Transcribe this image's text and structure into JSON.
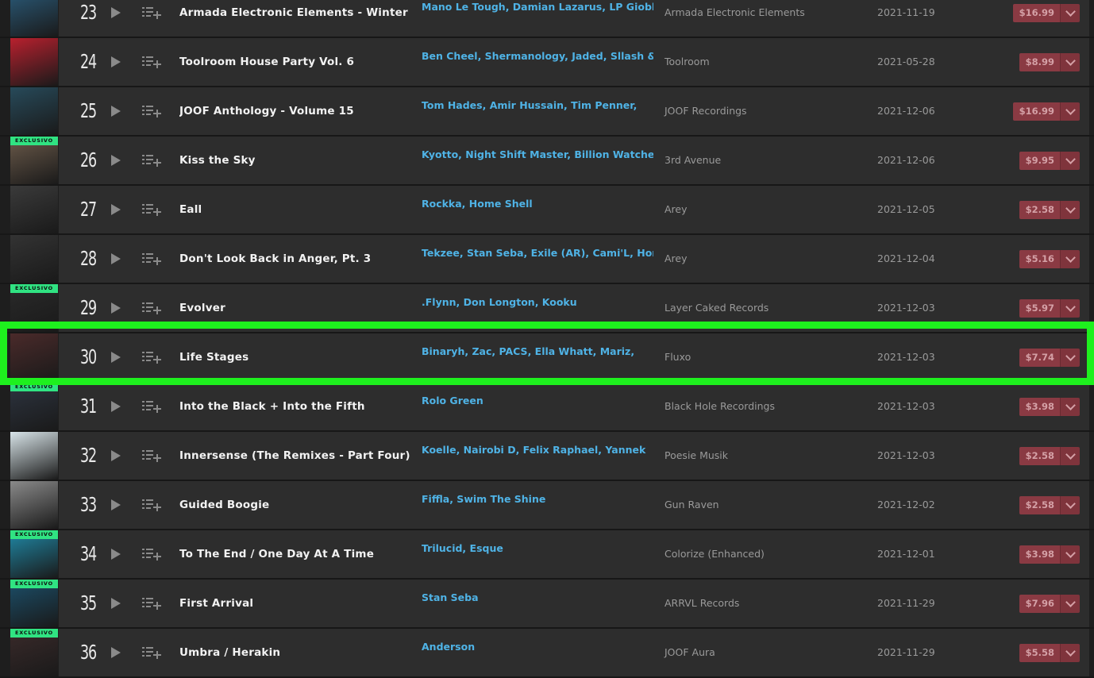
{
  "rows": [
    {
      "num": "23",
      "title": "Armada Electronic Elements - Winter",
      "artists": "Mano Le Tough, Damian Lazarus, LP Giobbi,",
      "label": "Armada Electronic Elements",
      "date": "2021-11-19",
      "price": "$16.99",
      "exclusive": "",
      "art_color": "#2a5b7a"
    },
    {
      "num": "24",
      "title": "Toolroom House Party Vol. 6",
      "artists": "Ben Cheel, Shermanology, Jaded, Sllash &",
      "label": "Toolroom",
      "date": "2021-05-28",
      "price": "$8.99",
      "exclusive": "",
      "art_color": "#b8202e"
    },
    {
      "num": "25",
      "title": "JOOF Anthology - Volume 15",
      "artists": "Tom Hades, Amir Hussain, Tim Penner,",
      "label": "JOOF Recordings",
      "date": "2021-12-06",
      "price": "$16.99",
      "exclusive": "",
      "art_color": "#274a5a"
    },
    {
      "num": "26",
      "title": "Kiss the Sky",
      "artists": "Kyotto, Night Shift Master, Billion Watchers,",
      "label": "3rd Avenue",
      "date": "2021-12-06",
      "price": "$9.95",
      "exclusive": "EXCLUSIVO",
      "art_color": "#6b5a4a"
    },
    {
      "num": "27",
      "title": "Eall",
      "artists": "Rockka, Home Shell",
      "label": "Arey",
      "date": "2021-12-05",
      "price": "$2.58",
      "exclusive": "",
      "art_color": "#3a3a3a"
    },
    {
      "num": "28",
      "title": "Don't Look Back in Anger, Pt. 3",
      "artists": "Tekzee, Stan Seba, Exile (AR), Cami'L, Home",
      "label": "Arey",
      "date": "2021-12-04",
      "price": "$5.16",
      "exclusive": "",
      "art_color": "#333333"
    },
    {
      "num": "29",
      "title": "Evolver",
      "artists": ".Flynn, Don Longton, Kooku",
      "label": "Layer Caked Records",
      "date": "2021-12-03",
      "price": "$5.97",
      "exclusive": "EXCLUSIVO",
      "art_color": "#2a2a2a"
    },
    {
      "num": "30",
      "title": "Life Stages",
      "artists": "Binaryh, Zac, PACS, Ella Whatt, Mariz,",
      "label": "Fluxo",
      "date": "2021-12-03",
      "price": "$7.74",
      "exclusive": "",
      "art_color": "#4a2a2a"
    },
    {
      "num": "31",
      "title": "Into the Black + Into the Fifth",
      "artists": "Rolo Green",
      "label": "Black Hole Recordings",
      "date": "2021-12-03",
      "price": "$3.98",
      "exclusive": "EXCLUSIVO",
      "art_color": "#2d3440"
    },
    {
      "num": "32",
      "title": "Innersense (The Remixes - Part Four)",
      "artists": "Koelle, Nairobi D, Felix Raphael, Yannek",
      "label": "Poesie Musik",
      "date": "2021-12-03",
      "price": "$2.58",
      "exclusive": "",
      "art_color": "#d8e4e8"
    },
    {
      "num": "33",
      "title": "Guided Boogie",
      "artists": "Fiffla, Swim The Shine",
      "label": "Gun Raven",
      "date": "2021-12-02",
      "price": "$2.58",
      "exclusive": "",
      "art_color": "#8a8a8a"
    },
    {
      "num": "34",
      "title": "To The End / One Day At A Time",
      "artists": "Trilucid, Esque",
      "label": "Colorize (Enhanced)",
      "date": "2021-12-01",
      "price": "$3.98",
      "exclusive": "EXCLUSIVO",
      "art_color": "#1f8aa8"
    },
    {
      "num": "35",
      "title": "First Arrival",
      "artists": "Stan Seba",
      "label": "ARRVL Records",
      "date": "2021-11-29",
      "price": "$7.96",
      "exclusive": "EXCLUSIVO",
      "art_color": "#1b4f6a"
    },
    {
      "num": "36",
      "title": "Umbra / Herakin",
      "artists": "Anderson",
      "label": "JOOF Aura",
      "date": "2021-11-29",
      "price": "$5.58",
      "exclusive": "EXCLUSIVO",
      "art_color": "#3a2a2a"
    }
  ],
  "colors": {
    "highlight": "#1ef01e",
    "artist_link": "#4fb3e6",
    "exclusive_badge": "#30e382",
    "buy_button": "#8a3a43"
  },
  "icons": {
    "play": "play-icon",
    "add_to_queue": "add-to-queue-icon",
    "dropdown": "chevron-down-icon"
  }
}
